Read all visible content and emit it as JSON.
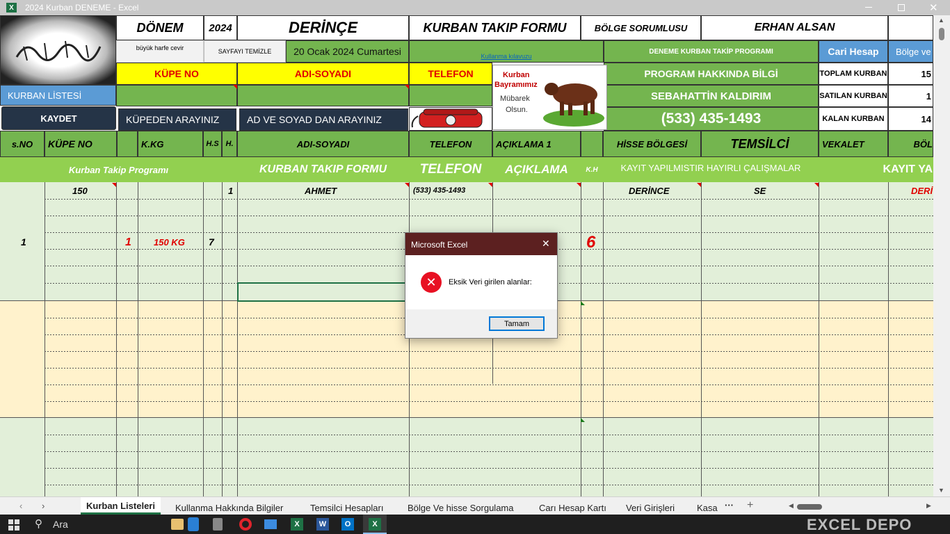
{
  "window": {
    "title": "2024 Kurban DENEME - Excel",
    "app_icon": "X"
  },
  "header": {
    "donem_label": "DÖNEM",
    "year": "2024",
    "location": "DERİNÇE",
    "form_title": "KURBAN TAKIP FORMU",
    "bolge_label": "BÖLGE SORUMLUSU",
    "bolge_name": "ERHAN ALSAN",
    "btn_uppercase": "büyük harfe cevir",
    "btn_clear": "SAYFAYI TEMİZLE",
    "date": "20 Ocak 2024 Cumartesi",
    "guide_link": "Kullanma kılavuzu",
    "program_name": "DENEME KURBAN TAKİP PROGRAMI",
    "cari_hesap": "Cari Hesap",
    "bolge_ver": "Bölge ve",
    "label_kupe": "KÜPE NO",
    "label_adsoyad": "ADI-SOYADI",
    "label_telefon": "TELEFON",
    "program_info": "PROGRAM HAKKINDA BİLGİ",
    "author": "SEBAHATTİN KALDIRIM",
    "phone": "(533) 435-1493",
    "toplam_label": "TOPLAM KURBAN",
    "toplam_value": "15",
    "satilan_label": "SATILAN KURBAN",
    "satilan_value": "1",
    "kalan_label": "KALAN KURBAN",
    "kalan_value": "14",
    "btn_list": "KURBAN LİSTESİ",
    "btn_save": "KAYDET",
    "search_kupe": "KÜPEDEN ARAYINIZ",
    "search_ad": "AD VE SOYAD DAN ARAYINIZ",
    "eid_line1": "Kurban",
    "eid_line2": "Bayramımız",
    "eid_line3": "Mübarek",
    "eid_line4": "Olsun."
  },
  "columns": {
    "sno": "s.NO",
    "kupe": "KÜPE NO",
    "kkg": "K.KG",
    "hs": "H.S",
    "h": "H.",
    "adsoyad": "ADI-SOYADI",
    "telefon": "TELEFON",
    "aciklama1": "AÇIKLAMA 1",
    "hisse": "HİSSE BÖLGESİ",
    "temsilci": "TEMSİLCİ",
    "vekalet": "VEKALET",
    "bol": "BÖL"
  },
  "banner": {
    "program": "Kurban Takip Programı",
    "form": "KURBAN TAKIP FORMU",
    "telefon": "TELEFON",
    "aciklama": "AÇIKLAMA",
    "kh": "K.H",
    "kayit": "KAYIT YAPILMISTIR HAYIRLI ÇALIŞMALAR",
    "kayit2": "KAYIT YA"
  },
  "record": {
    "sno": "1",
    "kupe": "150",
    "red_no": "1",
    "kg": "150 KG",
    "hs": "7",
    "h": "1",
    "name": "AHMET",
    "phone": "(533) 435-1493",
    "kh": "6",
    "bolge": "DERİNCE",
    "temsilci": "SE",
    "red_right": "DERİ"
  },
  "dialog": {
    "title": "Microsoft Excel",
    "message": "Eksik Veri girilen alanlar:",
    "ok": "Tamam"
  },
  "sheet_tabs": [
    "Kurban Listeleri",
    "Kullanma Hakkında Bilgiler",
    "Temsilci Hesapları",
    "Bölge Ve hisse Sorgulama",
    "Carı Hesap Kartı",
    "Veri Girişleri",
    "Kasa"
  ],
  "taskbar": {
    "search": "Ara",
    "watermark": "EXCEL DEPO"
  },
  "colors": {
    "green": "#74b54f",
    "light_green": "#e2efd9",
    "cream": "#fff2cc",
    "dark_btn": "#253447",
    "red": "#e00000"
  }
}
